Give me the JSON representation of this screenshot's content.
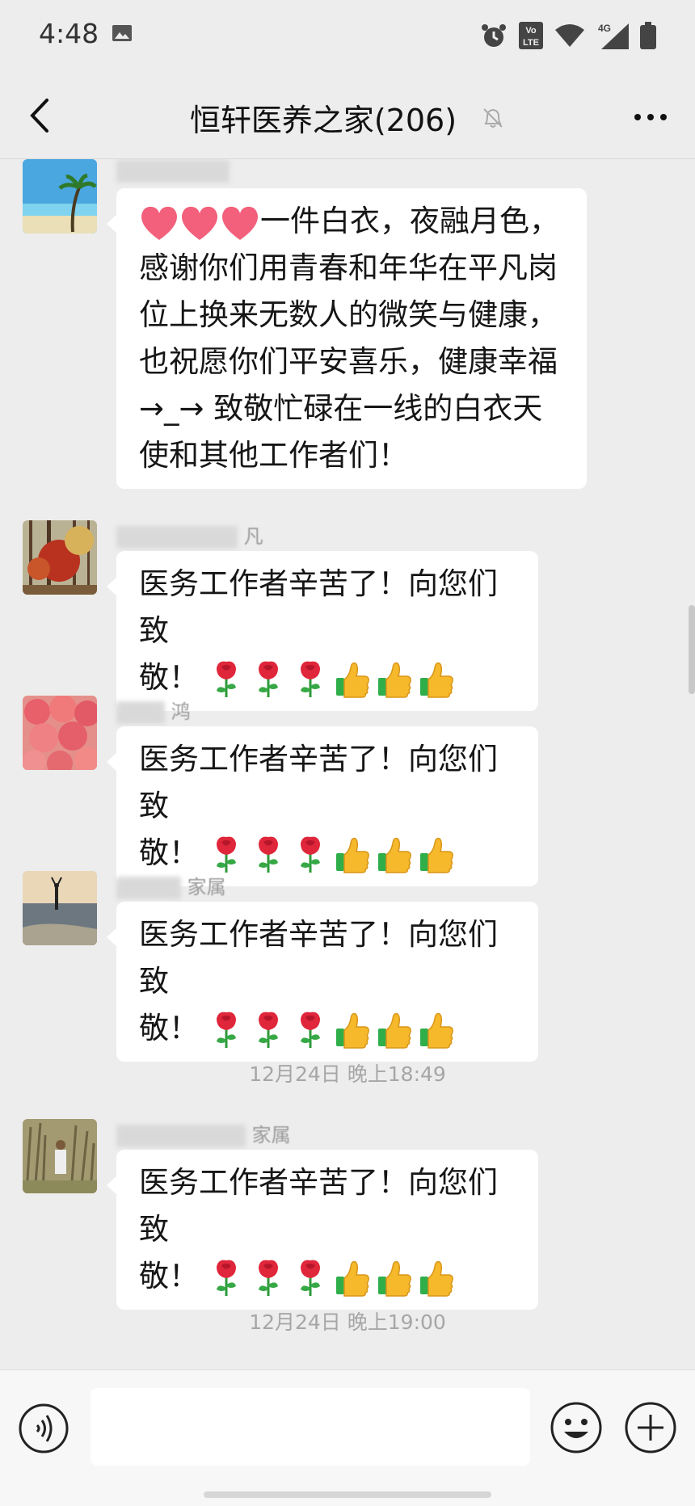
{
  "status_bar": {
    "time": "4:48",
    "icons": [
      "image-icon",
      "alarm-icon",
      "volte-icon",
      "wifi-icon",
      "signal-4g-icon",
      "battery-icon"
    ],
    "network_label": "4G",
    "volte_label": "Vo LTE"
  },
  "header": {
    "title": "恒轩医养之家(206)",
    "icons": [
      "back-icon",
      "mute-bell-icon",
      "more-icon"
    ]
  },
  "messages": [
    {
      "sender": "",
      "text_lines": [
        "一件白衣，夜融月色，",
        "感谢你们用青春和年华在平凡岗",
        "位上换来无数人的微笑与健康，",
        "也祝愿你们平安喜乐，健康幸福",
        "→_→ 致敬忙碌在一线的白衣天",
        "使和其他工作者们！"
      ]
    },
    {
      "sender": "凡",
      "text_line1": "医务工作者辛苦了！向您们致",
      "text_line2": "敬！"
    },
    {
      "sender": "鸿",
      "text_line1": "医务工作者辛苦了！向您们致",
      "text_line2": "敬！"
    },
    {
      "sender": "家属",
      "text_line1": "医务工作者辛苦了！向您们致",
      "text_line2": "敬！"
    },
    {
      "sender": "家属",
      "text_line1": "医务工作者辛苦了！向您们致",
      "text_line2": "敬！"
    }
  ],
  "timestamps": [
    "12月24日 晚上18:49",
    "12月24日 晚上19:00"
  ],
  "emoji_row": [
    "rose-emoji",
    "rose-emoji",
    "rose-emoji",
    "thumbs-up-emoji",
    "thumbs-up-emoji",
    "thumbs-up-emoji"
  ],
  "input_bar": {
    "placeholder": "",
    "icons": [
      "voice-icon",
      "emoji-icon",
      "plus-icon"
    ]
  },
  "colors": {
    "background": "#ededed",
    "bubble": "#ffffff",
    "timestamp": "#a6a6a6"
  }
}
